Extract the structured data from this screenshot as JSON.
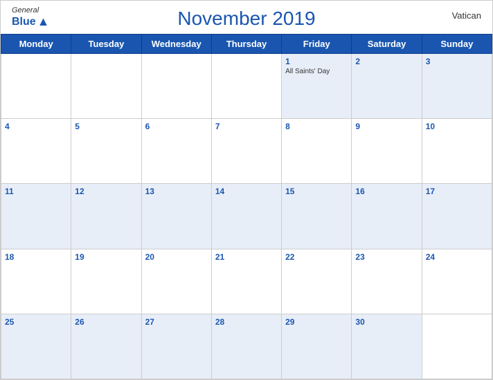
{
  "header": {
    "month_year": "November 2019",
    "country": "Vatican",
    "logo": {
      "general": "General",
      "blue": "Blue"
    }
  },
  "weekdays": [
    "Monday",
    "Tuesday",
    "Wednesday",
    "Thursday",
    "Friday",
    "Saturday",
    "Sunday"
  ],
  "weeks": [
    [
      {
        "day": "",
        "event": ""
      },
      {
        "day": "",
        "event": ""
      },
      {
        "day": "",
        "event": ""
      },
      {
        "day": "",
        "event": ""
      },
      {
        "day": "1",
        "event": "All Saints' Day"
      },
      {
        "day": "2",
        "event": ""
      },
      {
        "day": "3",
        "event": ""
      }
    ],
    [
      {
        "day": "4",
        "event": ""
      },
      {
        "day": "5",
        "event": ""
      },
      {
        "day": "6",
        "event": ""
      },
      {
        "day": "7",
        "event": ""
      },
      {
        "day": "8",
        "event": ""
      },
      {
        "day": "9",
        "event": ""
      },
      {
        "day": "10",
        "event": ""
      }
    ],
    [
      {
        "day": "11",
        "event": ""
      },
      {
        "day": "12",
        "event": ""
      },
      {
        "day": "13",
        "event": ""
      },
      {
        "day": "14",
        "event": ""
      },
      {
        "day": "15",
        "event": ""
      },
      {
        "day": "16",
        "event": ""
      },
      {
        "day": "17",
        "event": ""
      }
    ],
    [
      {
        "day": "18",
        "event": ""
      },
      {
        "day": "19",
        "event": ""
      },
      {
        "day": "20",
        "event": ""
      },
      {
        "day": "21",
        "event": ""
      },
      {
        "day": "22",
        "event": ""
      },
      {
        "day": "23",
        "event": ""
      },
      {
        "day": "24",
        "event": ""
      }
    ],
    [
      {
        "day": "25",
        "event": ""
      },
      {
        "day": "26",
        "event": ""
      },
      {
        "day": "27",
        "event": ""
      },
      {
        "day": "28",
        "event": ""
      },
      {
        "day": "29",
        "event": ""
      },
      {
        "day": "30",
        "event": ""
      },
      {
        "day": "",
        "event": ""
      }
    ]
  ]
}
